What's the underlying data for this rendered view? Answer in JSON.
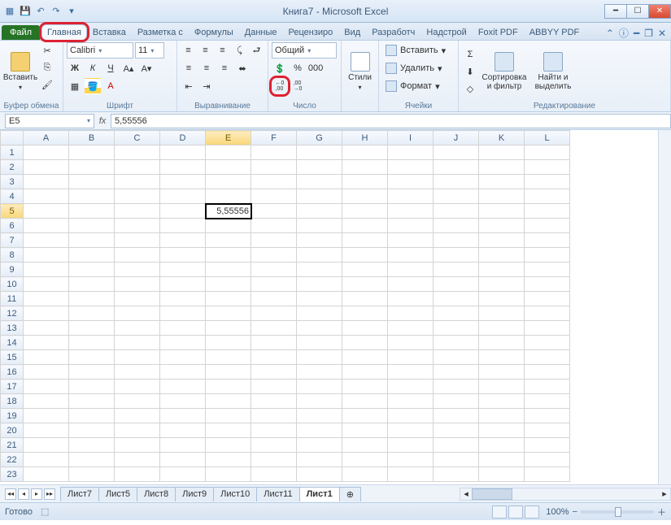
{
  "title": "Книга7  -  Microsoft Excel",
  "qat_icons": [
    "excel-icon",
    "save-icon",
    "undo-icon",
    "redo-icon",
    "print-icon"
  ],
  "file_tab": "Файл",
  "tabs": [
    "Главная",
    "Вставка",
    "Разметка с",
    "Формулы",
    "Данные",
    "Рецензиро",
    "Вид",
    "Разработч",
    "Надстрой",
    "Foxit PDF",
    "ABBYY PDF"
  ],
  "active_tab_index": 0,
  "highlighted_tab_index": 0,
  "ribbon": {
    "groups": {
      "clipboard": {
        "label": "Буфер обмена",
        "paste": "Вставить"
      },
      "font": {
        "label": "Шрифт",
        "name": "Calibri",
        "size": "11",
        "buttons": {
          "bold": "Ж",
          "italic": "К",
          "underline": "Ч"
        }
      },
      "alignment": {
        "label": "Выравнивание"
      },
      "number": {
        "label": "Число",
        "format": "Общий",
        "increase_decimal": "←0\n,00",
        "decrease_decimal": ",00\n→0"
      },
      "styles": {
        "label": "",
        "btn": "Стили"
      },
      "cells": {
        "label": "Ячейки",
        "insert": "Вставить",
        "delete": "Удалить",
        "format": "Формат"
      },
      "editing": {
        "label": "Редактирование",
        "sort": "Сортировка\nи фильтр",
        "find": "Найти и\nвыделить"
      }
    }
  },
  "namebox": "E5",
  "formula": "5,55556",
  "columns": [
    "A",
    "B",
    "C",
    "D",
    "E",
    "F",
    "G",
    "H",
    "I",
    "J",
    "K",
    "L"
  ],
  "active_col": "E",
  "row_count": 23,
  "active_row": 5,
  "cell_value": "5,55556",
  "cell_col": 4,
  "cell_row": 4,
  "sheets": [
    "Лист7",
    "Лист5",
    "Лист8",
    "Лист9",
    "Лист10",
    "Лист11",
    "Лист1"
  ],
  "active_sheet_index": 6,
  "status": {
    "ready": "Готово",
    "zoom": "100%"
  }
}
